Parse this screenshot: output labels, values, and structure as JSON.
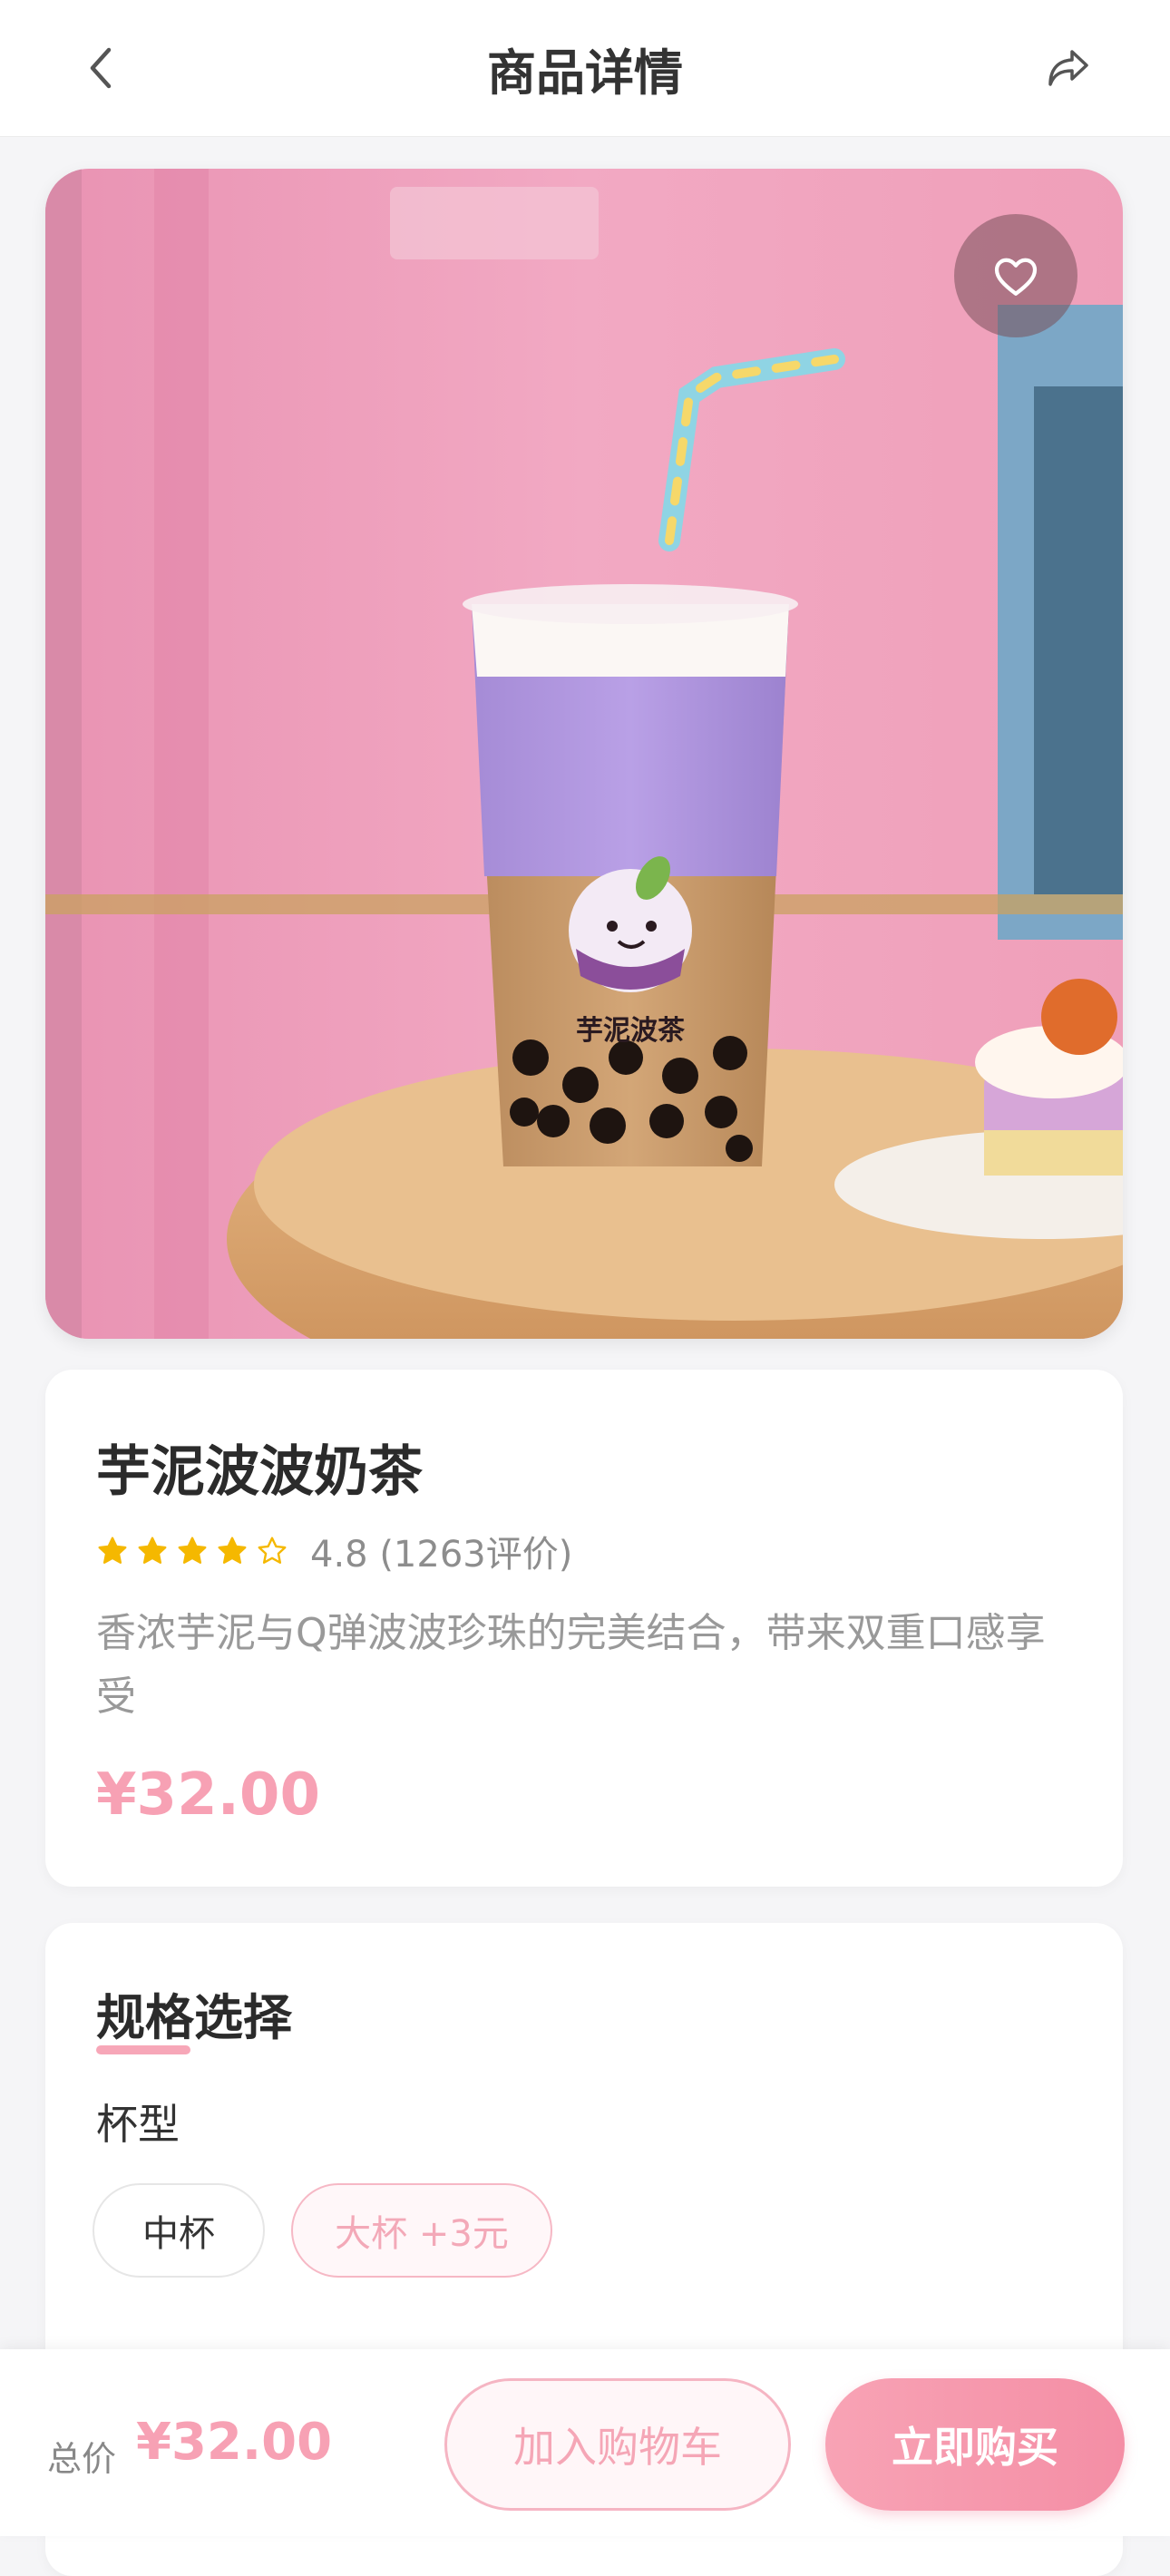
{
  "header": {
    "title": "商品详情",
    "back_icon": "chevron-left-icon",
    "share_icon": "share-icon"
  },
  "product_image": {
    "cup_text": "芋泥波茶",
    "favorite_icon": "heart-icon"
  },
  "product": {
    "name": "芋泥波波奶茶",
    "rating_value": 4.8,
    "rating_text": "4.8 (1263评价)",
    "stars": [
      "full",
      "full",
      "full",
      "full",
      "empty"
    ],
    "description": "香浓芋泥与Q弹波波珍珠的完美结合，带来双重口感享受",
    "price": "¥32.00"
  },
  "spec": {
    "title": "规格选择",
    "cup_label": "杯型",
    "options": [
      {
        "label": "中杯",
        "selected": false
      },
      {
        "label": "大杯 +3元",
        "selected": true
      }
    ]
  },
  "bottom_bar": {
    "total_label": "总价",
    "total_price": "¥32.00",
    "add_to_cart": "加入购物车",
    "buy_now": "立即购买"
  },
  "colors": {
    "accent": "#f7a1b4",
    "star": "#f5b800",
    "background": "#f5f5f7"
  }
}
